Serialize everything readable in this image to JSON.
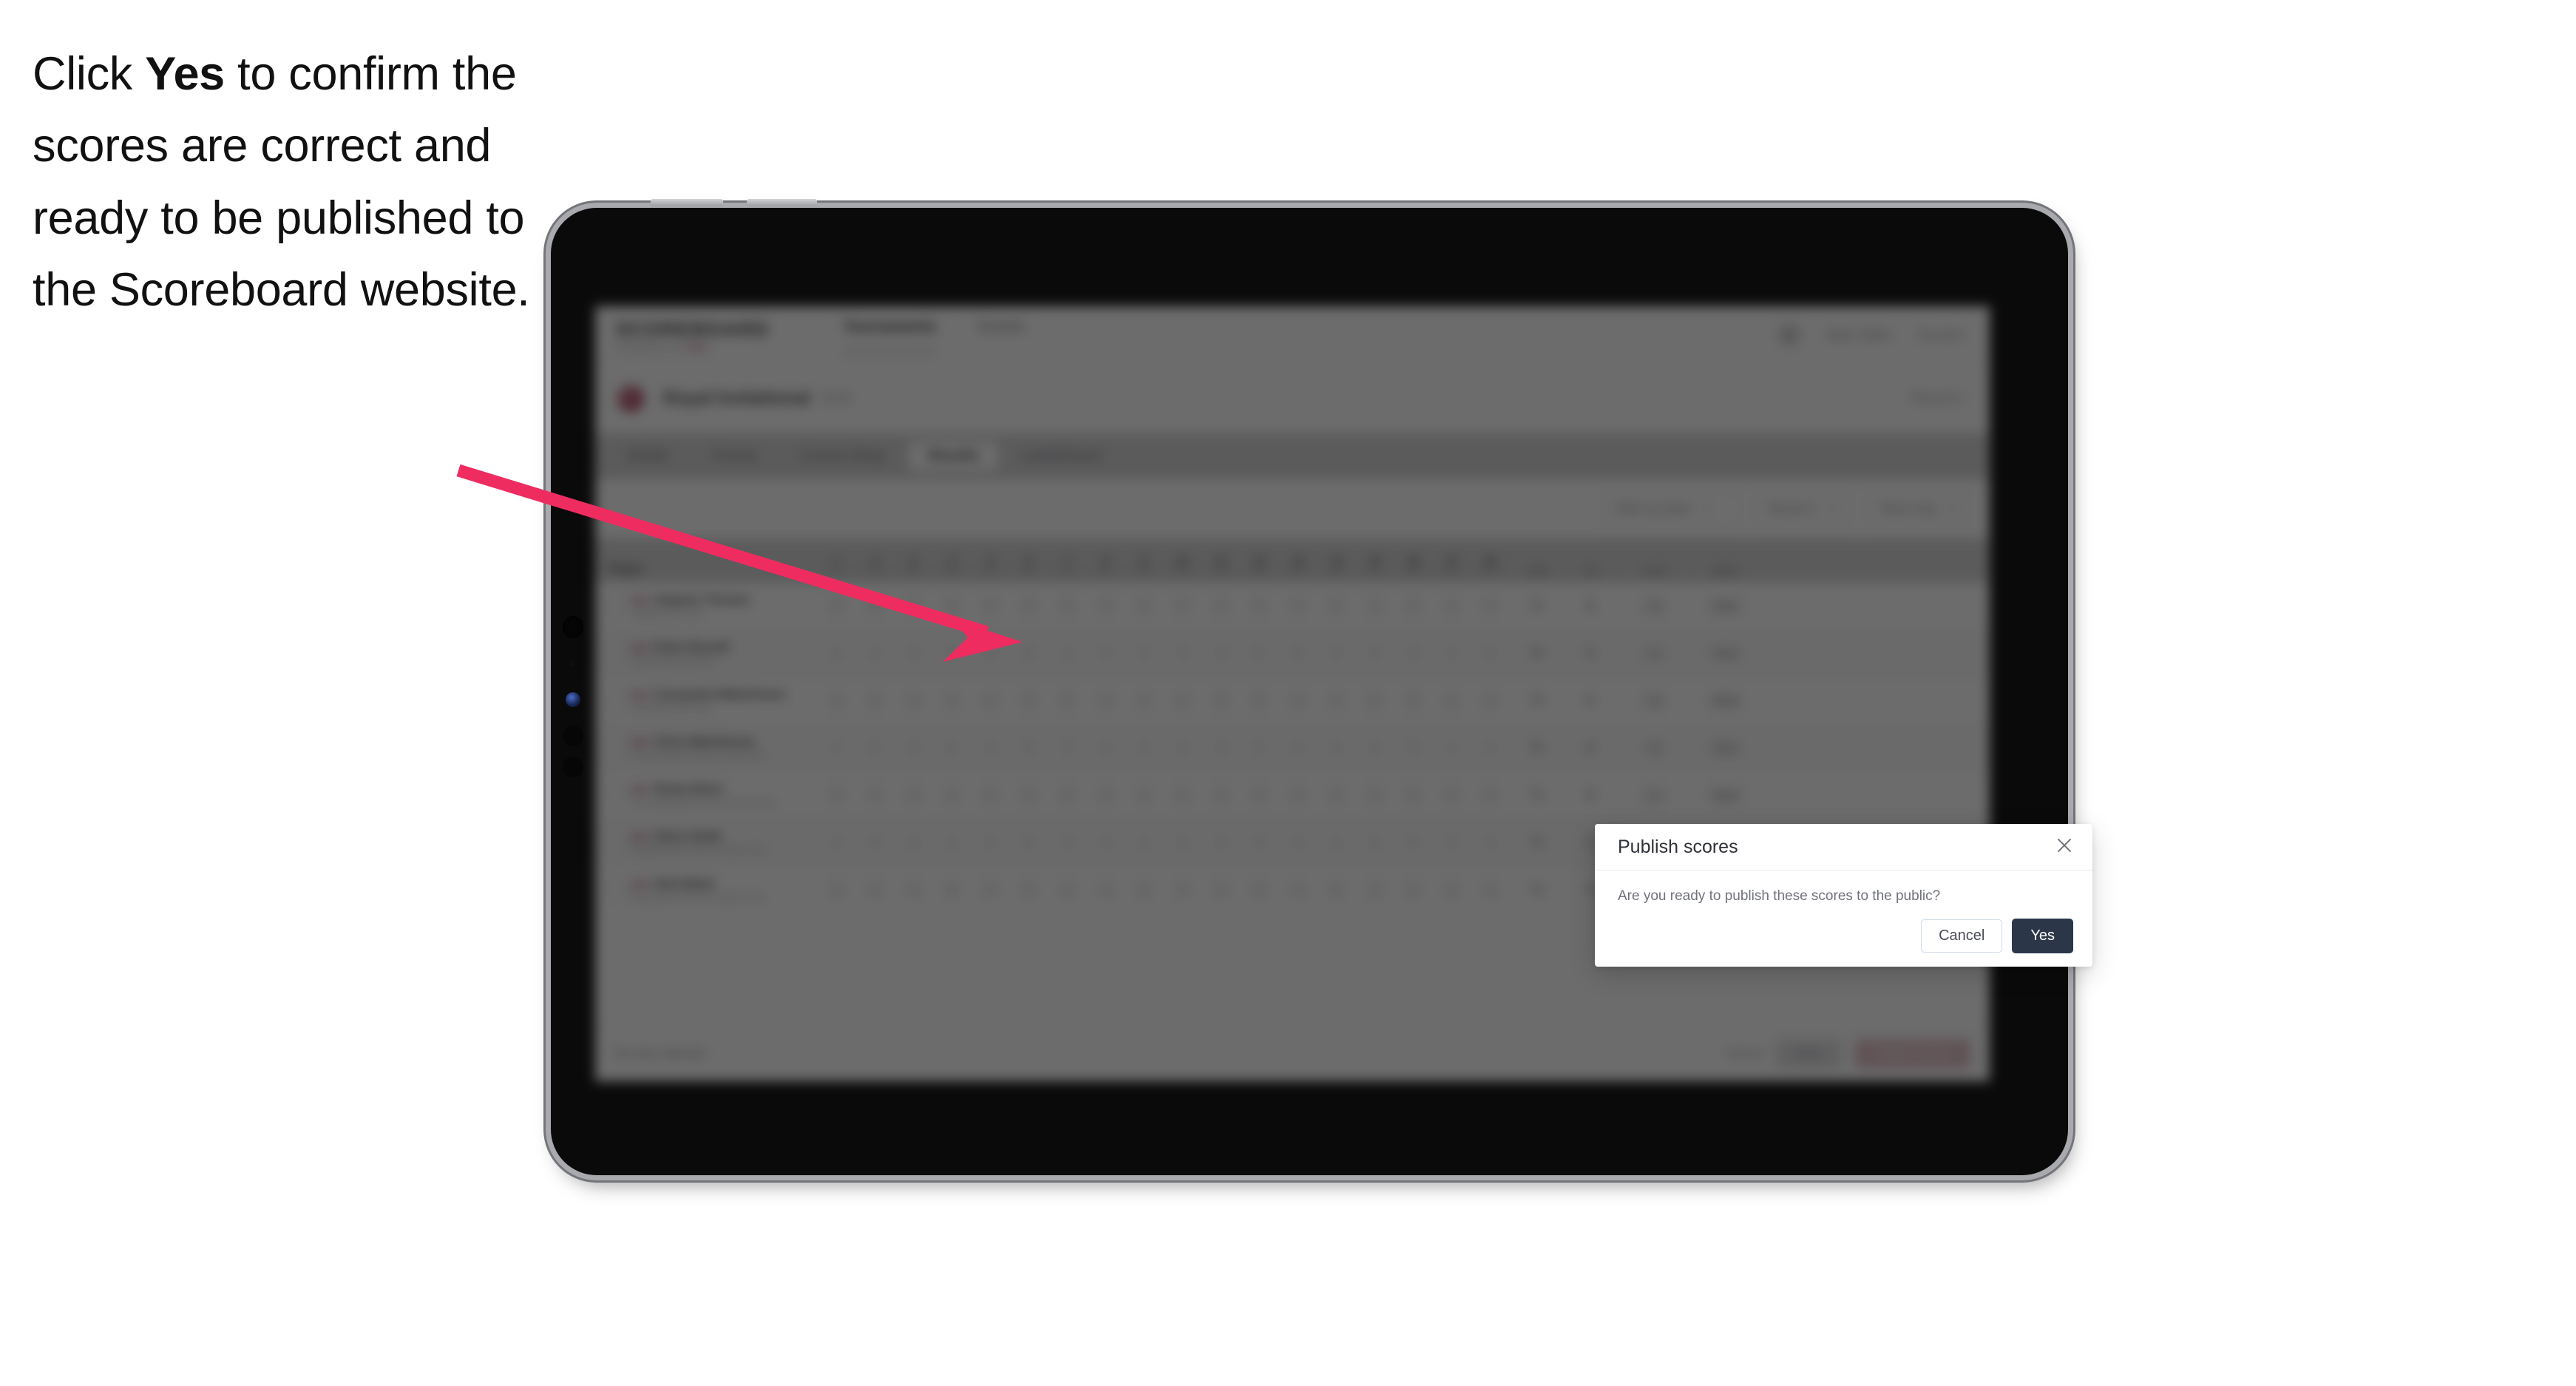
{
  "caption": {
    "part1": "Click ",
    "emphasis": "Yes",
    "part2": " to confirm the scores are correct and ready to be published to the Scoreboard website."
  },
  "annotation": {
    "arrow_color": "#ee2c60",
    "arrow_name": "pointer-arrow-to-yes-button"
  },
  "device": {
    "type": "tablet",
    "frame_color": "#0a0a0a",
    "bezel_color": "#a9aaad"
  },
  "app": {
    "brand": {
      "name": "SCOREBOARD",
      "tagline": "POWERED BY",
      "tagline_accent": "PRO"
    },
    "nav": [
      {
        "label": "Tournaments",
        "active": true
      },
      {
        "label": "Events",
        "active": false
      }
    ],
    "header_right": {
      "user": "Mark Gibbs",
      "menu": "Account"
    },
    "competition": {
      "title": "Royal Invitational",
      "subtitle": "2024",
      "right_label": "Round 2"
    },
    "tabs": [
      {
        "label": "Details",
        "active": false
      },
      {
        "label": "Format",
        "active": false
      },
      {
        "label": "Course Setup",
        "active": false
      },
      {
        "label": "Results",
        "active": true
      },
      {
        "label": "Leaderboard",
        "active": false
      }
    ],
    "filters": [
      {
        "label": "Filter by team",
        "has_chevron": true
      },
      {
        "label": "Round 1",
        "has_chevron": true
      },
      {
        "label": "Team only",
        "has_chevron": true
      }
    ],
    "table": {
      "columns": {
        "player": "Player",
        "holes": [
          {
            "num": "1",
            "par": "Par 4"
          },
          {
            "num": "2",
            "par": "Par 5"
          },
          {
            "num": "3",
            "par": "Par 3"
          },
          {
            "num": "4",
            "par": "Par 4"
          },
          {
            "num": "5",
            "par": "Par 4"
          },
          {
            "num": "6",
            "par": "Par 5"
          },
          {
            "num": "7",
            "par": "Par 3"
          },
          {
            "num": "8",
            "par": "Par 4"
          },
          {
            "num": "9",
            "par": "Par 4"
          },
          {
            "num": "10",
            "par": "Par 4"
          },
          {
            "num": "11",
            "par": "Par 3"
          },
          {
            "num": "12",
            "par": "Par 5"
          },
          {
            "num": "13",
            "par": "Par 4"
          },
          {
            "num": "14",
            "par": "Par 4"
          },
          {
            "num": "15",
            "par": "Par 3"
          },
          {
            "num": "16",
            "par": "Par 5"
          },
          {
            "num": "17",
            "par": "Par 4"
          },
          {
            "num": "18",
            "par": "Par 4"
          }
        ],
        "total": "Total",
        "par": "Par",
        "score": "Score",
        "status": "Status"
      },
      "rows": [
        {
          "flag": "ENG",
          "name": "Stephen Thomas",
          "club": "Oakford Golf Club",
          "scores": [
            "4",
            "5",
            "3",
            "4",
            "4",
            "5",
            "3",
            "4",
            "4",
            "4",
            "3",
            "5",
            "4",
            "4",
            "3",
            "5",
            "4",
            "4"
          ],
          "total": "72",
          "par": "E",
          "score": "+2",
          "status": "Final"
        },
        {
          "flag": "ENG",
          "name": "Peter Russell",
          "club": "Kingswood Golf Club",
          "scores": [
            "5",
            "4",
            "3",
            "4",
            "5",
            "5",
            "3",
            "4",
            "4",
            "4",
            "3",
            "5",
            "5",
            "4",
            "3",
            "5",
            "4",
            "4"
          ],
          "total": "74",
          "par": "E",
          "score": "+3",
          "status": "Final"
        },
        {
          "flag": "ENG",
          "name": "Cassandra Waterhouse",
          "club": "Brookdale Golf Club",
          "scores": [
            "4",
            "4",
            "4",
            "4",
            "4",
            "5",
            "3",
            "4",
            "4",
            "4",
            "3",
            "5",
            "4",
            "4",
            "3",
            "5",
            "4",
            "4"
          ],
          "total": "73",
          "par": "E",
          "score": "+2",
          "status": "Final"
        },
        {
          "flag": "ENG",
          "name": "Chris Waterhouse",
          "club": "The Grosvenor Park Country Club",
          "scores": [
            "4",
            "5",
            "3",
            "5",
            "4",
            "5",
            "3",
            "4",
            "4",
            "4",
            "3",
            "5",
            "4",
            "5",
            "3",
            "5",
            "4",
            "4"
          ],
          "total": "75",
          "par": "E",
          "score": "+4",
          "status": "Final"
        },
        {
          "flag": "ENG",
          "name": "Rickie Blunt",
          "club": "The Heathlands Golf & Country Club",
          "scores": [
            "4",
            "4",
            "3",
            "4",
            "4",
            "5",
            "3",
            "4",
            "4",
            "4",
            "3",
            "5",
            "4",
            "4",
            "3",
            "5",
            "4",
            "4"
          ],
          "total": "71",
          "par": "E",
          "score": "+1",
          "status": "Final"
        },
        {
          "flag": "ENG",
          "name": "Steve Smith",
          "club": "Hartfield Park Golf & Country Club",
          "scores": [
            "4",
            "5",
            "3",
            "4",
            "4",
            "5",
            "3",
            "4",
            "4",
            "4",
            "3",
            "5",
            "4",
            "4",
            "3",
            "5",
            "4",
            "4"
          ],
          "total": "72",
          "par": "E",
          "score": "+2",
          "status": "Final"
        },
        {
          "flag": "ENG",
          "name": "Nick Baker",
          "club": "Ravensworth Golf & Country Club",
          "scores": [
            "4",
            "4",
            "3",
            "4",
            "5",
            "5",
            "3",
            "4",
            "4",
            "4",
            "3",
            "5",
            "4",
            "4",
            "3",
            "5",
            "4",
            "4"
          ],
          "total": "73",
          "par": "E",
          "score": "+2",
          "status": "Final"
        }
      ]
    },
    "bottom_bar": {
      "note": "No rows selected",
      "link": "Cancel",
      "secondary_button": "Save",
      "primary_button": "Publish scores"
    }
  },
  "modal": {
    "title": "Publish scores",
    "body": "Are you ready to publish these scores to the public?",
    "cancel_label": "Cancel",
    "confirm_label": "Yes",
    "close_icon": "close-icon"
  }
}
